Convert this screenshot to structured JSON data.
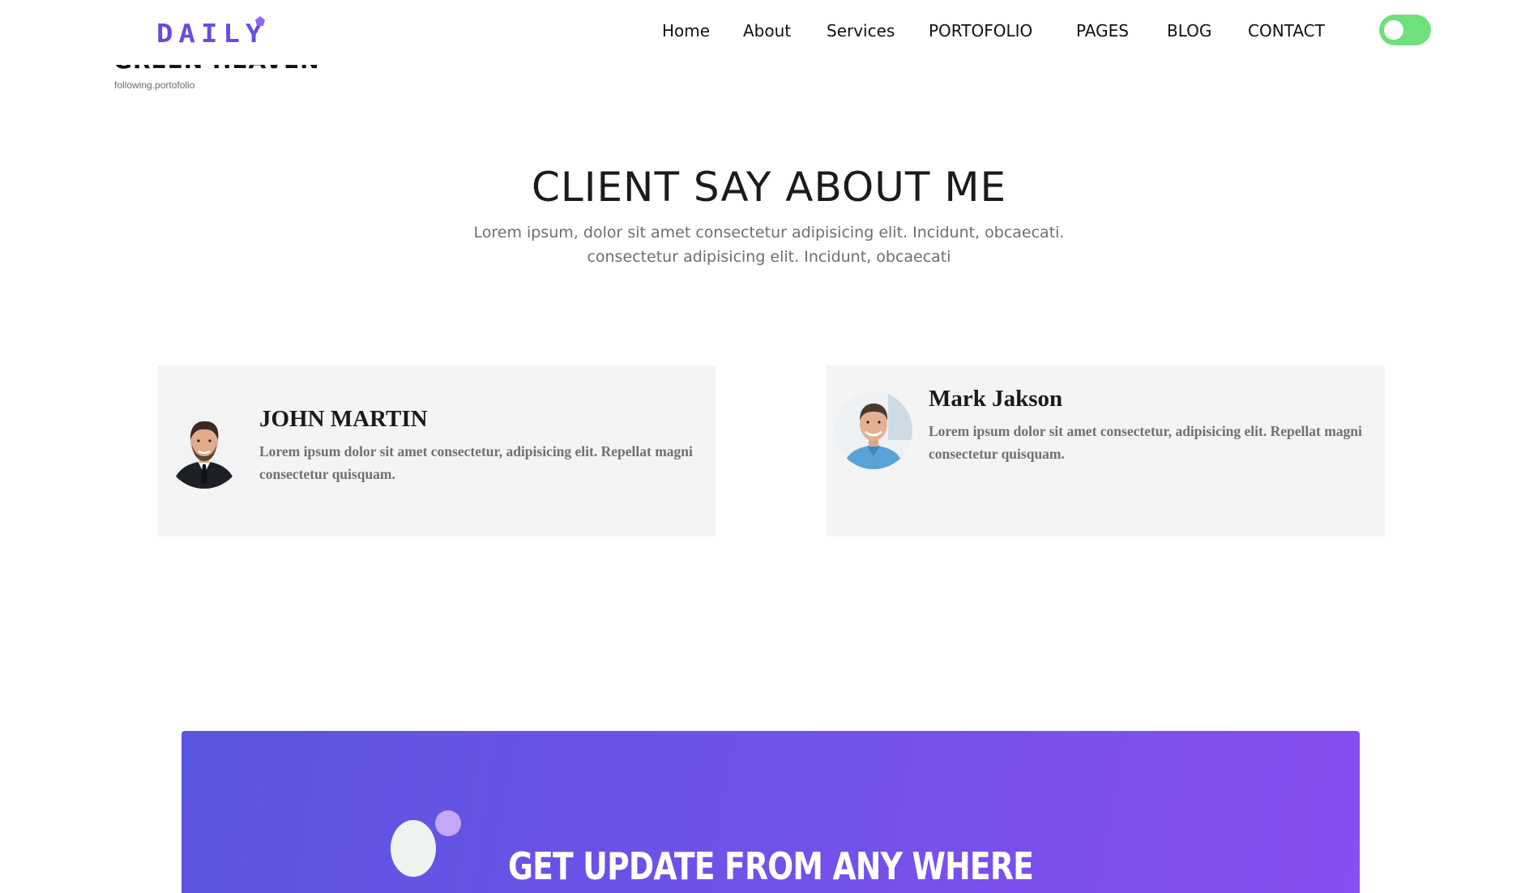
{
  "header": {
    "logo_text": "DAILY",
    "nav": [
      {
        "label": "Home"
      },
      {
        "label": "About"
      },
      {
        "label": "Services"
      },
      {
        "label": "PORTOFOLIO"
      },
      {
        "label": "PAGES"
      },
      {
        "label": "BLOG"
      },
      {
        "label": "CONTACT"
      }
    ],
    "theme_toggle": {
      "state": "on",
      "color": "#6fe07c"
    }
  },
  "portfolio_caption": {
    "title": "GREEN HEAVEN",
    "subtitle": "following.portofolio"
  },
  "testimonials": {
    "title": "CLIENT SAY ABOUT ME",
    "subtitle_line1": "Lorem ipsum, dolor sit amet consectetur adipisicing elit. Incidunt, obcaecati.",
    "subtitle_line2": "consectetur adipisicing elit. Incidunt, obcaecati",
    "cards": [
      {
        "name": "JOHN MARTIN",
        "text": "Lorem ipsum dolor sit amet consectetur, adipisicing elit. Repellat magni consectetur quisquam.",
        "avatar": "man-in-suit-avatar"
      },
      {
        "name": "Mark Jakson",
        "text": "Lorem ipsum dolor sit amet consectetur, adipisicing elit. Repellat magni consectetur quisquam.",
        "avatar": "man-in-blue-shirt-avatar"
      }
    ]
  },
  "newsletter": {
    "title": "GET UPDATE FROM ANY WHERE",
    "gradient_start": "#5a55e0",
    "gradient_end": "#874ef0"
  },
  "colors": {
    "accent": "#6c4ae0",
    "card_background": "#f4f4f4"
  }
}
